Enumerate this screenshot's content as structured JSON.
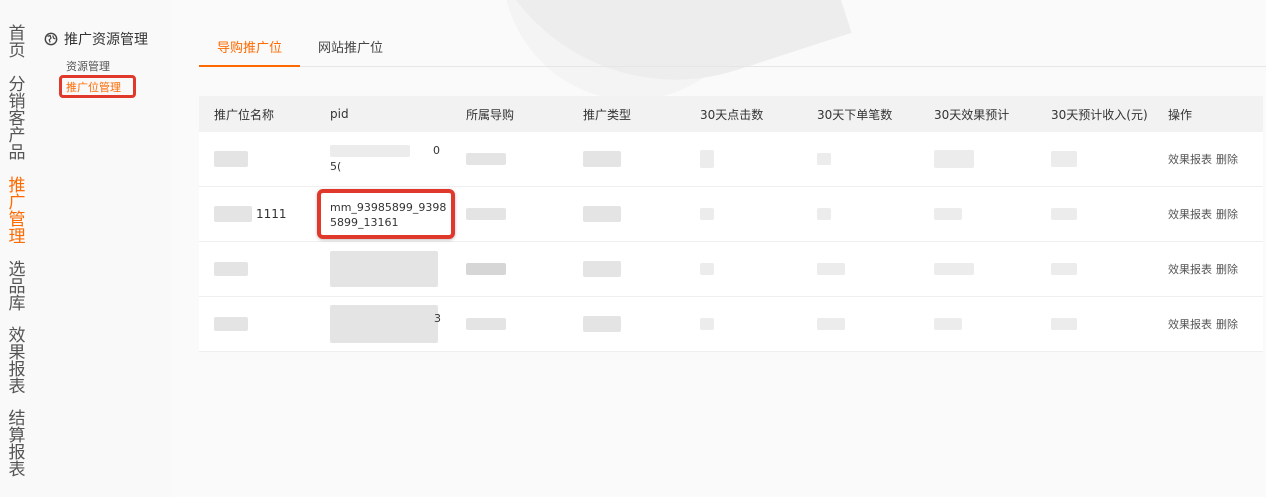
{
  "vnav": [
    {
      "label": "首页",
      "active": false
    },
    {
      "label": "分销客产品",
      "active": false
    },
    {
      "label": "推广管理",
      "active": true
    },
    {
      "label": "选品库",
      "active": false
    },
    {
      "label": "效果报表",
      "active": false
    },
    {
      "label": "结算报表",
      "active": false
    }
  ],
  "sidebar": {
    "header": "推广资源管理",
    "items": [
      "资源管理",
      "推广位管理"
    ],
    "active_index": 1
  },
  "tabs": [
    {
      "label": "导购推广位",
      "active": true
    },
    {
      "label": "网站推广位",
      "active": false
    }
  ],
  "table": {
    "columns": [
      "推广位名称",
      "pid",
      "所属导购",
      "推广类型",
      "30天点击数",
      "30天下单笔数",
      "30天效果预计",
      "30天预计收入(元)",
      "操作"
    ],
    "rows": [
      {
        "name": "",
        "pid_line1": "0",
        "pid_line2": "5(",
        "actions": [
          "效果报表",
          "删除"
        ]
      },
      {
        "name": "1111",
        "pid_line1": "mm_93985899_9398",
        "pid_line2": "5899_13161",
        "actions": [
          "效果报表",
          "删除"
        ]
      },
      {
        "name": "",
        "pid_line1": "",
        "pid_line2": "",
        "actions": [
          "效果报表",
          "删除"
        ]
      },
      {
        "name": "",
        "pid_line1": "3",
        "pid_line2": "",
        "actions": [
          "效果报表",
          "删除"
        ]
      }
    ]
  },
  "colors": {
    "accent": "#ff6a00",
    "highlight": "#e0392b"
  }
}
